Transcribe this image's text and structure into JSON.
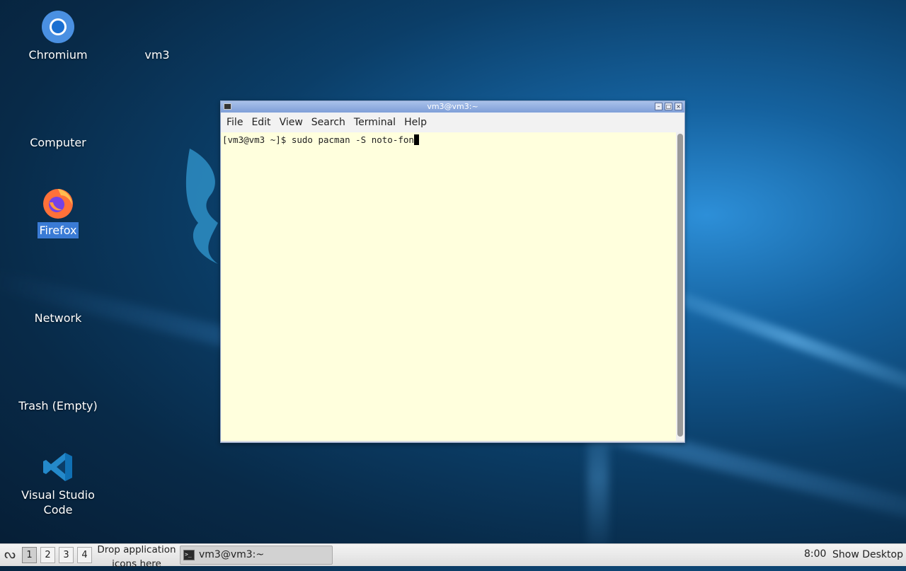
{
  "desktop": {
    "icons": [
      {
        "label": "Chromium"
      },
      {
        "label": "vm3"
      },
      {
        "label": "Computer"
      },
      {
        "label": "Firefox"
      },
      {
        "label": "Network"
      },
      {
        "label": "Trash (Empty)"
      },
      {
        "label": "Visual Studio Code"
      }
    ]
  },
  "window": {
    "title": "vm3@vm3:~",
    "menu": [
      "File",
      "Edit",
      "View",
      "Search",
      "Terminal",
      "Help"
    ],
    "terminal": {
      "prompt": "[vm3@vm3 ~]$ ",
      "command": "sudo pacman -S noto-fon"
    }
  },
  "taskbar": {
    "workspaces": [
      "1",
      "2",
      "3",
      "4"
    ],
    "active_workspace": "1",
    "drop_text": "Drop application icons here",
    "task_label": "vm3@vm3:~",
    "clock": "8:00",
    "show_desktop": "Show Desktop"
  },
  "colors": {
    "terminal_bg": "#ffffdd",
    "selection": "#3a7bd5",
    "titlebar": "#8fa9dc"
  }
}
